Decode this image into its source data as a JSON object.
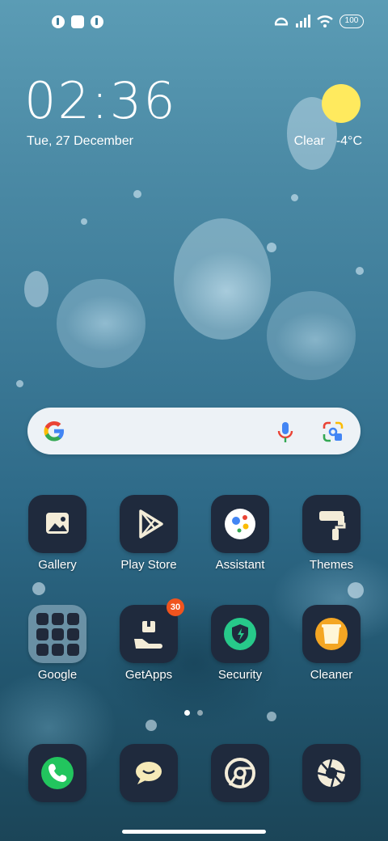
{
  "status_bar": {
    "left_icons": [
      "notification-icon-1",
      "notification-icon-2",
      "notification-icon-3"
    ],
    "right_icons": [
      "alarm-icon",
      "signal-icon",
      "wifi-icon"
    ],
    "battery": "100"
  },
  "clock_widget": {
    "time": "02:36",
    "date": "Tue, 27 December"
  },
  "weather_widget": {
    "condition": "Clear",
    "temperature": "-4°C",
    "icon": "sun-icon",
    "color": "#ffea5e"
  },
  "search_bar": {
    "icons": [
      "google-logo-icon",
      "microphone-icon",
      "google-lens-icon"
    ]
  },
  "apps_row1": [
    {
      "label": "Gallery",
      "icon": "gallery-icon"
    },
    {
      "label": "Play Store",
      "icon": "play-store-icon"
    },
    {
      "label": "Assistant",
      "icon": "assistant-icon"
    },
    {
      "label": "Themes",
      "icon": "themes-icon"
    }
  ],
  "apps_row2": [
    {
      "label": "Google",
      "icon": "folder-icon"
    },
    {
      "label": "GetApps",
      "icon": "getapps-icon",
      "badge": "30"
    },
    {
      "label": "Security",
      "icon": "security-icon"
    },
    {
      "label": "Cleaner",
      "icon": "cleaner-icon"
    }
  ],
  "dock": [
    {
      "icon": "phone-icon"
    },
    {
      "icon": "messages-icon"
    },
    {
      "icon": "chrome-icon"
    },
    {
      "icon": "camera-icon"
    }
  ],
  "page_indicator": {
    "pages": 2,
    "current": 1
  },
  "colors": {
    "tile": "#1f2a3d",
    "badge": "#f0541e",
    "security": "#27c98a",
    "cleaner": "#f4a623",
    "phone": "#22c55e"
  }
}
